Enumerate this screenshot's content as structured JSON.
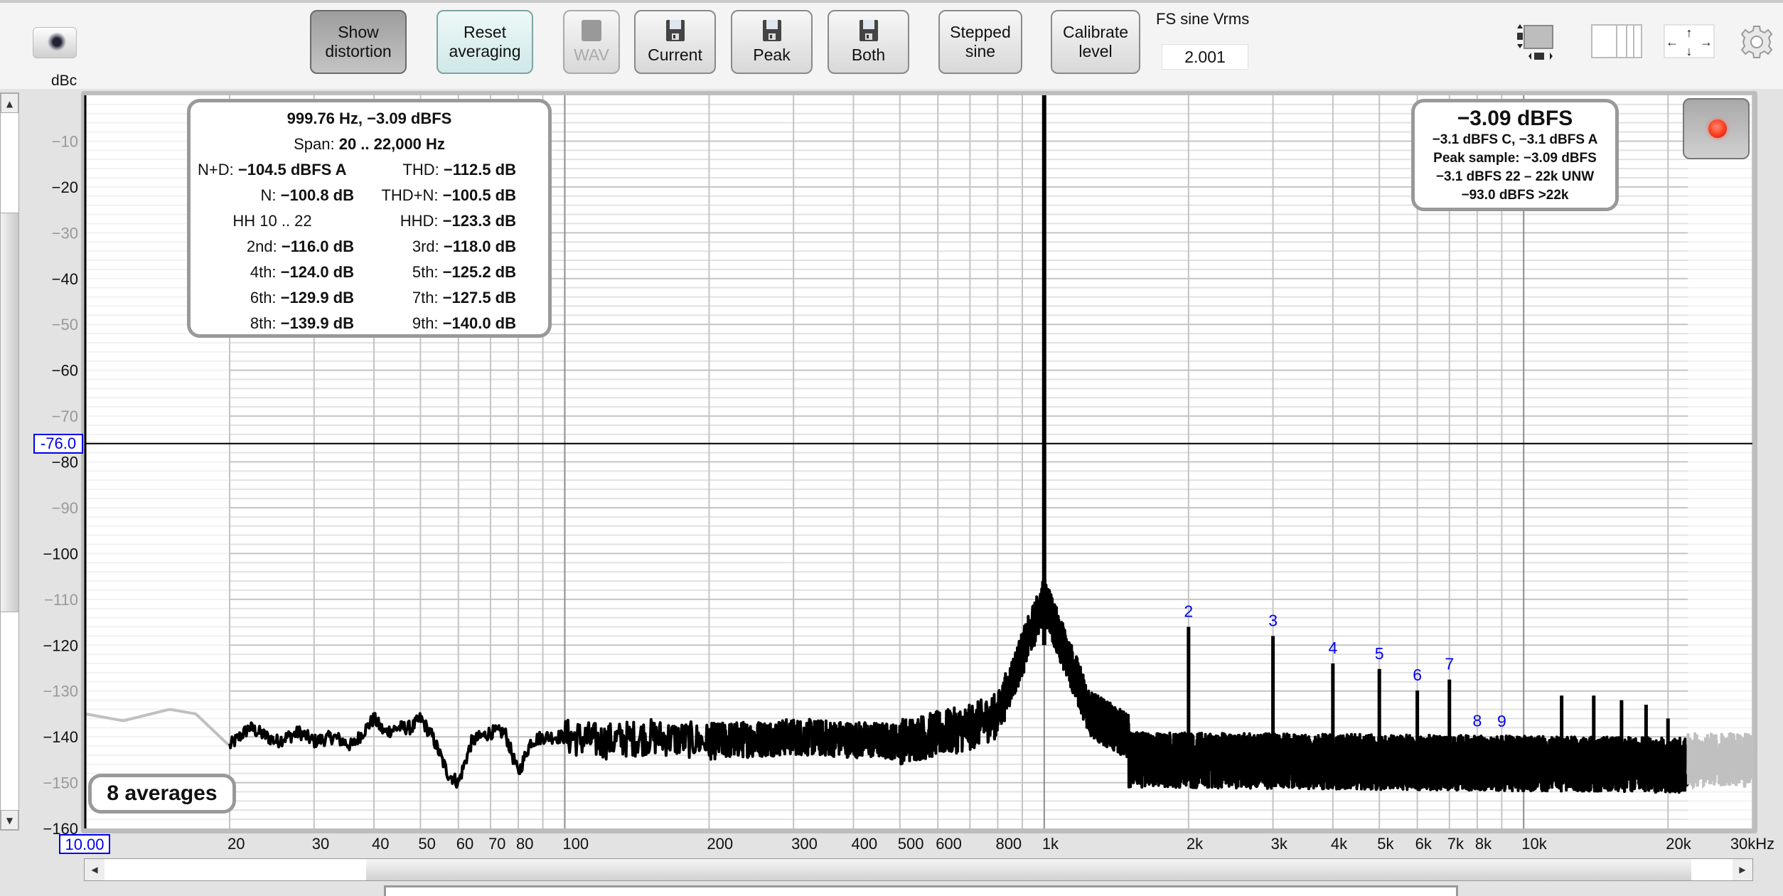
{
  "toolbar": {
    "snapshot_icon": "camera-icon",
    "buttons": [
      {
        "id": "show-distortion",
        "label": "Show\ndistortion",
        "state": "pressed"
      },
      {
        "id": "reset-averaging",
        "label": "Reset\naveraging",
        "state": "normal"
      },
      {
        "id": "wav",
        "label": "WAV",
        "icon": "folder-icon",
        "state": "disabled"
      },
      {
        "id": "save-current",
        "label": "Current",
        "icon": "floppy-disk-icon",
        "state": "normal"
      },
      {
        "id": "save-peak",
        "label": "Peak",
        "icon": "floppy-disk-icon",
        "state": "normal"
      },
      {
        "id": "save-both",
        "label": "Both",
        "icon": "floppy-disk-icon",
        "state": "normal"
      },
      {
        "id": "stepped-sine",
        "label": "Stepped\nsine",
        "state": "normal"
      },
      {
        "id": "calibrate-level",
        "label": "Calibrate\nlevel",
        "state": "normal"
      }
    ],
    "fs_sine_label": "FS sine Vrms",
    "fs_sine_value": "2.001",
    "right_icons": [
      "resize-graph-icon",
      "column-layout-icon",
      "pan-arrows-icon",
      "settings-gear-icon"
    ]
  },
  "axis": {
    "y_unit": "dBc",
    "cursor_y_value": "-76.0",
    "x_start_value": "10.00"
  },
  "info_panel": {
    "title": "999.76 Hz, −3.09 dBFS",
    "span_label": "Span:",
    "span_value": "20 .. 22,000 Hz",
    "rows": [
      [
        {
          "label": "N+D:",
          "value": "−104.5 dBFS A"
        },
        {
          "label": "THD:",
          "value": "−112.5 dB"
        }
      ],
      [
        {
          "label": "N:",
          "value": "−100.8 dB"
        },
        {
          "label": "THD+N:",
          "value": "−100.5 dB"
        }
      ],
      [
        {
          "label": "HH 10 .. 22",
          "value": ""
        },
        {
          "label": "HHD:",
          "value": "−123.3 dB"
        }
      ],
      [
        {
          "label": "2nd:",
          "value": "−116.0 dB"
        },
        {
          "label": "3rd:",
          "value": "−118.0 dB"
        }
      ],
      [
        {
          "label": "4th:",
          "value": "−124.0 dB"
        },
        {
          "label": "5th:",
          "value": "−125.2 dB"
        }
      ],
      [
        {
          "label": "6th:",
          "value": "−129.9 dB"
        },
        {
          "label": "7th:",
          "value": "−127.5 dB"
        }
      ],
      [
        {
          "label": "8th:",
          "value": "−139.9 dB"
        },
        {
          "label": "9th:",
          "value": "−140.0 dB"
        }
      ]
    ]
  },
  "level_panel": {
    "main": "−3.09 dBFS",
    "lines": [
      "−3.1 dBFS C, −3.1 dBFS A",
      "Peak sample: −3.09 dBFS",
      "−3.1 dBFS 22 – 22k UNW",
      "−93.0 dBFS >22k"
    ]
  },
  "averages_badge": "8 averages",
  "record_button": {
    "icon": "record-icon",
    "color": "#ff3b1f"
  },
  "colors": {
    "trace": "#000000",
    "trace_out_of_span": "#c0c0c0",
    "harmonic_label": "#0000ee",
    "cursor_label": "#0000ee"
  },
  "chart_data": {
    "type": "line",
    "title": "",
    "xlabel": "Hz",
    "ylabel": "dBc",
    "x_scale": "log",
    "xlim": [
      10,
      30000
    ],
    "ylim": [
      -160,
      0
    ],
    "grid": true,
    "x_ticks": [
      {
        "value": 20,
        "label": "20"
      },
      {
        "value": 30,
        "label": "30"
      },
      {
        "value": 40,
        "label": "40"
      },
      {
        "value": 50,
        "label": "50"
      },
      {
        "value": 60,
        "label": "60"
      },
      {
        "value": 70,
        "label": "70"
      },
      {
        "value": 80,
        "label": "80"
      },
      {
        "value": 100,
        "label": "100"
      },
      {
        "value": 200,
        "label": "200"
      },
      {
        "value": 300,
        "label": "300"
      },
      {
        "value": 400,
        "label": "400"
      },
      {
        "value": 500,
        "label": "500"
      },
      {
        "value": 600,
        "label": "600"
      },
      {
        "value": 800,
        "label": "800"
      },
      {
        "value": 1000,
        "label": "1k"
      },
      {
        "value": 2000,
        "label": "2k"
      },
      {
        "value": 3000,
        "label": "3k"
      },
      {
        "value": 4000,
        "label": "4k"
      },
      {
        "value": 5000,
        "label": "5k"
      },
      {
        "value": 6000,
        "label": "6k"
      },
      {
        "value": 7000,
        "label": "7k"
      },
      {
        "value": 8000,
        "label": "8k"
      },
      {
        "value": 10000,
        "label": "10k"
      },
      {
        "value": 20000,
        "label": "20k"
      },
      {
        "value": 30000,
        "label": "30kHz"
      }
    ],
    "y_ticks": [
      {
        "value": -10,
        "label": "-10",
        "major": false
      },
      {
        "value": -20,
        "label": "-20",
        "major": true
      },
      {
        "value": -30,
        "label": "-30",
        "major": false
      },
      {
        "value": -40,
        "label": "-40",
        "major": true
      },
      {
        "value": -50,
        "label": "-50",
        "major": false
      },
      {
        "value": -60,
        "label": "-60",
        "major": true
      },
      {
        "value": -70,
        "label": "-70",
        "major": false
      },
      {
        "value": -80,
        "label": "-80",
        "major": true
      },
      {
        "value": -90,
        "label": "-90",
        "major": false
      },
      {
        "value": -100,
        "label": "-100",
        "major": true
      },
      {
        "value": -110,
        "label": "-110",
        "major": false
      },
      {
        "value": -120,
        "label": "-120",
        "major": true
      },
      {
        "value": -130,
        "label": "-130",
        "major": false
      },
      {
        "value": -140,
        "label": "-140",
        "major": true
      },
      {
        "value": -150,
        "label": "-150",
        "major": false
      },
      {
        "value": -160,
        "label": "-160",
        "major": true
      }
    ],
    "span_hz": [
      20,
      22000
    ],
    "cursor_dbc": -76.0,
    "fundamental": {
      "freq_hz": 999.76,
      "level_dbc": 0
    },
    "harmonics": [
      {
        "n": 2,
        "label": "2",
        "freq_hz": 2000,
        "level_dbc": -116.0
      },
      {
        "n": 3,
        "label": "3",
        "freq_hz": 3000,
        "level_dbc": -118.0
      },
      {
        "n": 4,
        "label": "4",
        "freq_hz": 4000,
        "level_dbc": -124.0
      },
      {
        "n": 5,
        "label": "5",
        "freq_hz": 5000,
        "level_dbc": -125.2
      },
      {
        "n": 6,
        "label": "6",
        "freq_hz": 6000,
        "level_dbc": -129.9
      },
      {
        "n": 7,
        "label": "7",
        "freq_hz": 7000,
        "level_dbc": -127.5
      },
      {
        "n": 8,
        "label": "8",
        "freq_hz": 8000,
        "level_dbc": -139.9
      },
      {
        "n": 9,
        "label": "9",
        "freq_hz": 9000,
        "level_dbc": -140.0
      }
    ],
    "extra_spurs": [
      {
        "freq_hz": 12000,
        "level_dbc": -131
      },
      {
        "freq_hz": 14000,
        "level_dbc": -131
      },
      {
        "freq_hz": 16000,
        "level_dbc": -132
      },
      {
        "freq_hz": 18000,
        "level_dbc": -133
      },
      {
        "freq_hz": 20000,
        "level_dbc": -136
      }
    ],
    "noise_floor": {
      "low_band_below_20hz": [
        [
          10,
          -135
        ],
        [
          12,
          -136.5
        ],
        [
          15,
          -134
        ],
        [
          17,
          -135
        ],
        [
          20,
          -142
        ]
      ],
      "curve": [
        [
          20,
          -142
        ],
        [
          22,
          -138
        ],
        [
          25,
          -141
        ],
        [
          28,
          -139
        ],
        [
          30,
          -141
        ],
        [
          33,
          -140
        ],
        [
          36,
          -142
        ],
        [
          40,
          -136
        ],
        [
          42,
          -139
        ],
        [
          45,
          -138
        ],
        [
          48,
          -138
        ],
        [
          50,
          -136
        ],
        [
          53,
          -140
        ],
        [
          57,
          -148
        ],
        [
          60,
          -150
        ],
        [
          64,
          -141
        ],
        [
          70,
          -139
        ],
        [
          75,
          -139
        ],
        [
          80,
          -148
        ],
        [
          85,
          -141
        ],
        [
          90,
          -140
        ],
        [
          100,
          -140
        ],
        [
          120,
          -141
        ],
        [
          150,
          -140
        ],
        [
          200,
          -141
        ],
        [
          300,
          -140
        ],
        [
          500,
          -141
        ],
        [
          700,
          -138
        ],
        [
          850,
          -134
        ],
        [
          950,
          -126
        ],
        [
          999.76,
          0
        ],
        [
          1050,
          -126
        ],
        [
          1200,
          -134
        ],
        [
          1500,
          -140
        ],
        [
          2000,
          -143
        ],
        [
          5000,
          -144
        ],
        [
          10000,
          -145
        ],
        [
          22000,
          -146
        ]
      ],
      "floor_mean_above_1500hz_dbc": -145,
      "floor_spread_dbc": 6,
      "gray_region_above_22khz_dbc": -145
    }
  }
}
